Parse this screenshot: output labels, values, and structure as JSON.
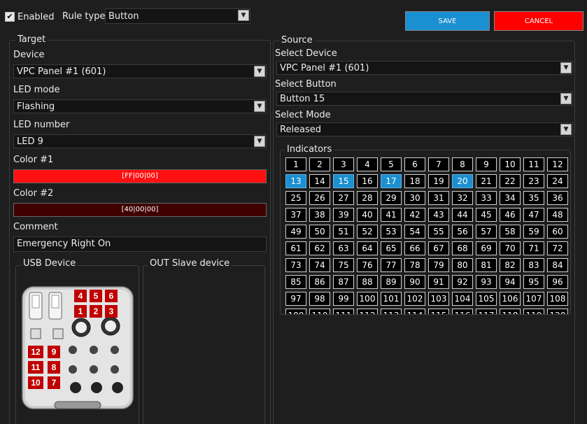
{
  "header": {
    "enabled_label": "Enabled",
    "enabled_check": "✔",
    "rule_type_label": "Rule type",
    "rule_type_value": "Button",
    "save_label": "SAVE",
    "cancel_label": "CANCEL"
  },
  "target": {
    "legend": "Target",
    "device_label": "Device",
    "device_value": "VPC Panel #1 (601)",
    "led_mode_label": "LED mode",
    "led_mode_value": "Flashing",
    "led_number_label": "LED number",
    "led_number_value": "LED 9",
    "color1_label": "Color #1",
    "color1_value": "[FF|00|00]",
    "color2_label": "Color #2",
    "color2_value": "[40|00|00]",
    "comment_label": "Comment",
    "comment_value": "Emergency Right On",
    "usb_legend": "USB Device",
    "out_legend": "OUT Slave device"
  },
  "device_labels": [
    "4",
    "5",
    "6",
    "1",
    "2",
    "3",
    "12",
    "9",
    "11",
    "8",
    "10",
    "7"
  ],
  "source": {
    "legend": "Source",
    "select_device_label": "Select Device",
    "select_device_value": "VPC Panel #1 (601)",
    "select_button_label": "Select Button",
    "select_button_value": "Button 15",
    "select_mode_label": "Select Mode",
    "select_mode_value": "Released",
    "indicators_legend": "Indicators"
  },
  "indicators": {
    "count": 132,
    "highlighted": [
      13,
      15,
      17,
      20
    ]
  },
  "colors": {
    "save": "#1a8fd1",
    "cancel": "#ff0000",
    "color1": "#ff1010",
    "color2": "#400000",
    "highlight": "#1c8fd0"
  }
}
